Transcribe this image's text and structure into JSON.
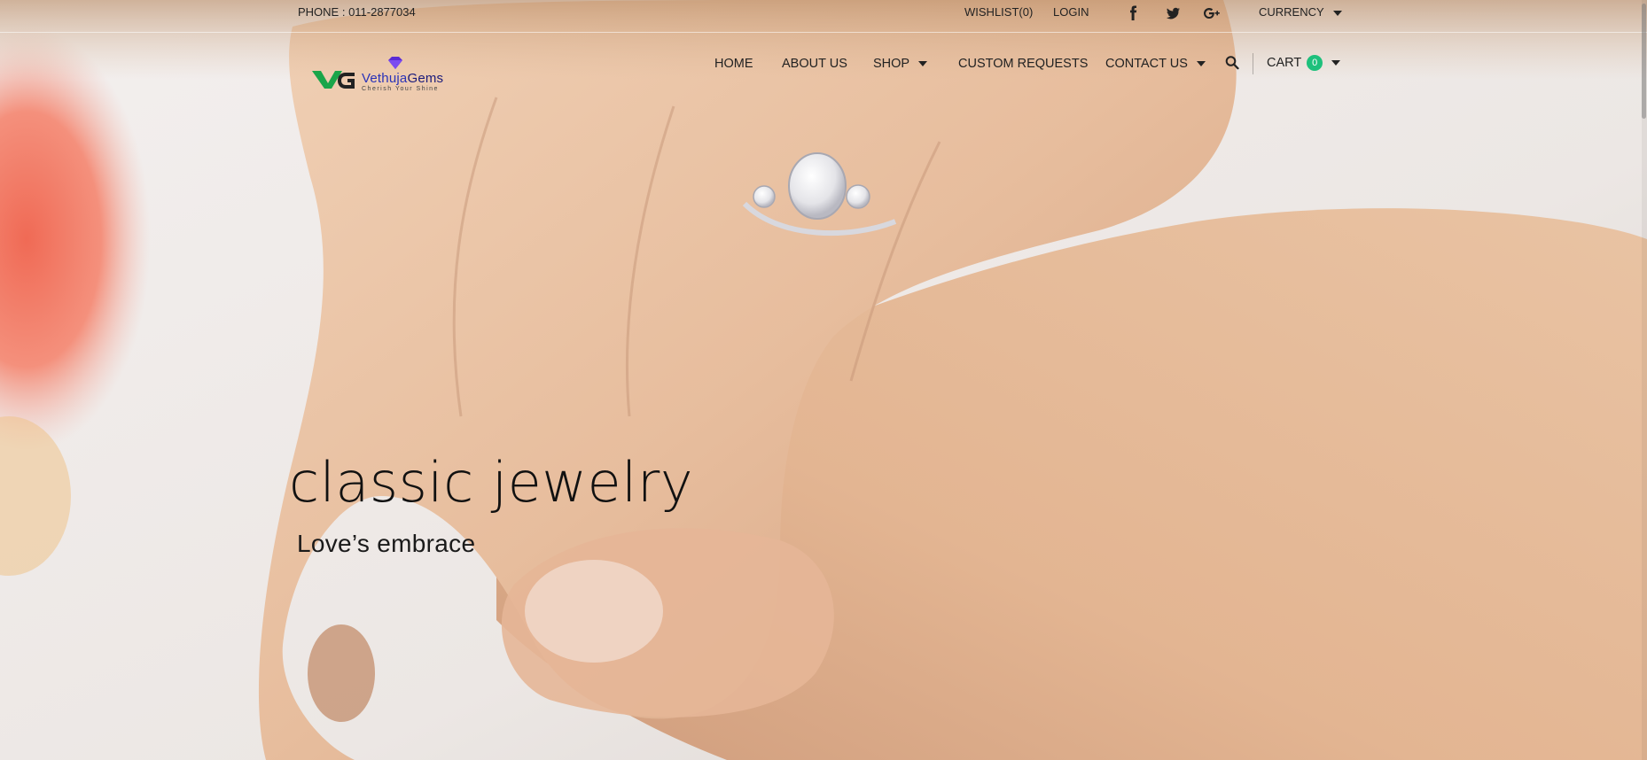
{
  "topbar": {
    "phone": "PHONE : 011-2877034",
    "wishlist": "WISHLIST(0)",
    "login": "LOGIN",
    "social_icons": [
      "facebook-icon",
      "twitter-icon",
      "google-plus-icon"
    ],
    "currency": "CURRENCY"
  },
  "logo": {
    "brand_left": "Vethuja",
    "brand_right": "Gems",
    "tagline": "Cherish Your Shine"
  },
  "nav": {
    "home": "HOME",
    "about": "ABOUT US",
    "shop": "SHOP",
    "custom": "CUSTOM REQUESTS",
    "contact": "CONTACT US",
    "cart": "CART",
    "cart_count": "0"
  },
  "hero": {
    "title": "classic jewelry",
    "subtitle": "Love’s embrace"
  },
  "colors": {
    "accent_green": "#1ec07c",
    "logo_blue": "#2a33b8",
    "logo_purple": "#5a2bd6"
  }
}
